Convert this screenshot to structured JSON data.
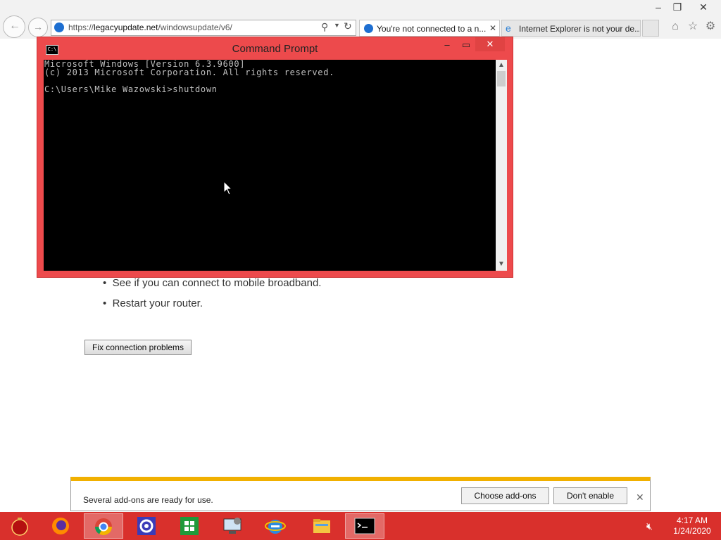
{
  "browser": {
    "url_prefix": "https://",
    "url_host": "legacyupdate.net",
    "url_path": "/windowsupdate/v6/",
    "tabs": [
      {
        "label": "You're not connected to a n...",
        "active": true
      },
      {
        "label": "Internet Explorer is not your de...",
        "active": false
      }
    ],
    "icons": {
      "back": "back-arrow-icon",
      "forward": "forward-arrow-icon",
      "search": "search-icon",
      "refresh": "refresh-icon",
      "home": "home-icon",
      "favorites": "star-icon",
      "settings": "gear-icon"
    }
  },
  "page": {
    "bullets": [
      "See if you can connect to mobile broadband.",
      "Restart your router."
    ],
    "fix_button": "Fix connection problems"
  },
  "notification": {
    "text": "Several add-ons are ready for use.",
    "choose_button": "Choose add-ons",
    "dont_enable_button": "Don't enable"
  },
  "cmd": {
    "title": "Command Prompt",
    "icon_text": "C:\\",
    "lines": [
      "Microsoft Windows [Version 6.3.9600]",
      "(c) 2013 Microsoft Corporation. All rights reserved.",
      "",
      "C:\\Users\\Mike Wazowski>shutdown"
    ]
  },
  "taskbar": {
    "apps": [
      "ornament",
      "firefox",
      "chrome",
      "settings",
      "store",
      "control-panel",
      "internet-explorer",
      "file-explorer",
      "command-prompt"
    ],
    "time": "4:17 AM",
    "date": "1/24/2020"
  },
  "colors": {
    "cmd_frame": "#ed4a4c",
    "taskbar": "#d9302c",
    "notify_accent": "#f1b000"
  }
}
